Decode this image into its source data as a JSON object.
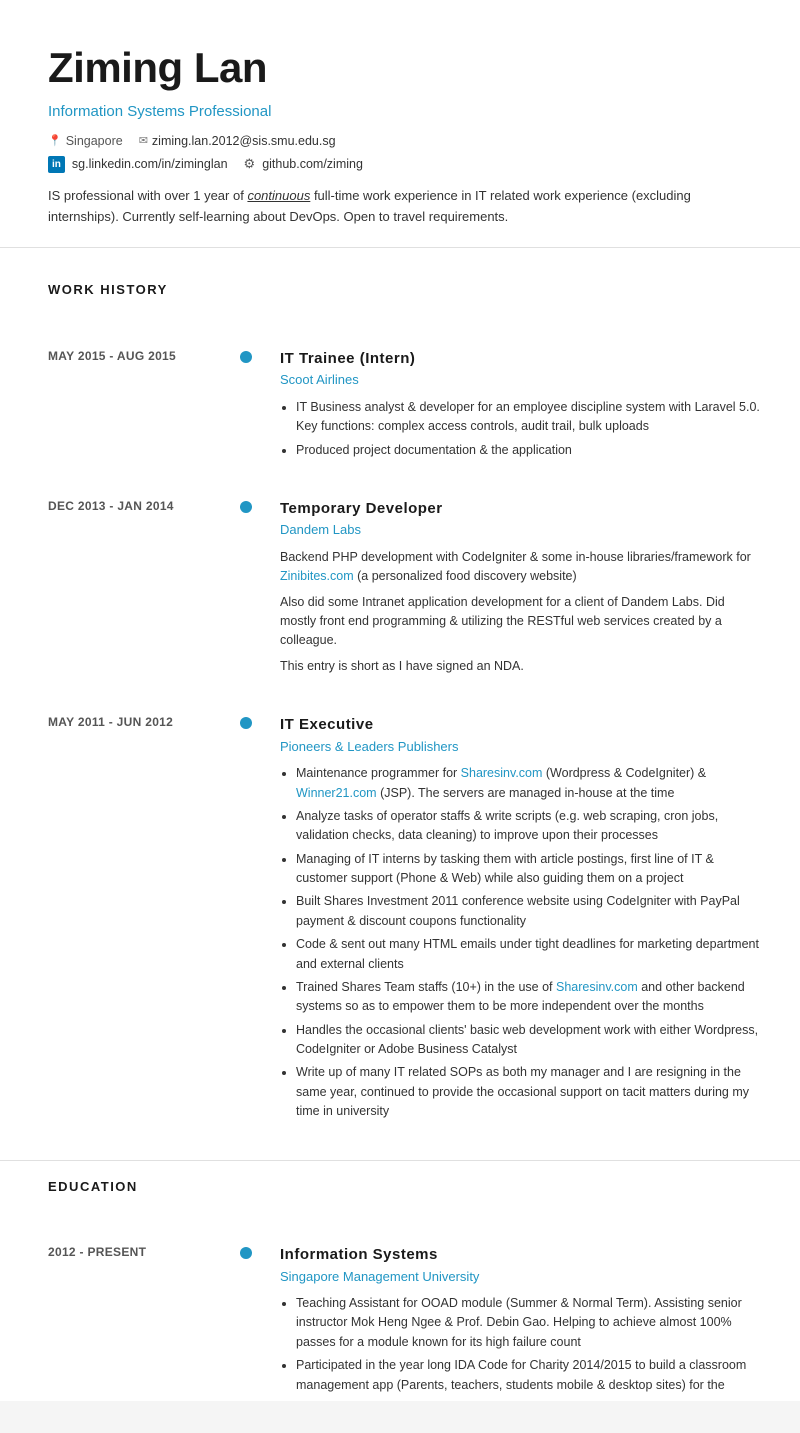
{
  "header": {
    "name": "Ziming Lan",
    "profession": "Information Systems Professional",
    "location": "Singapore",
    "email": "ziming.lan.2012@sis.smu.edu.sg",
    "linkedin_label": "in",
    "linkedin_url": "sg.linkedin.com/in/ziminglan",
    "github_url": "github.com/ziming",
    "summary": "IS professional with over 1 year of continuous full-time work experience in IT related work experience (excluding internships). Currently self-learning about DevOps. Open to travel requirements."
  },
  "sections": {
    "work_history_title": "WORK HISTORY",
    "education_title": "EDUCATION"
  },
  "work_entries": [
    {
      "dates": "MAY 2015 - AUG 2015",
      "title": "IT Trainee (Intern)",
      "company": "Scoot Airlines",
      "bullets": [
        "IT Business analyst & developer for an employee discipline system with Laravel 5.0. Key functions: complex access controls, audit trail, bulk uploads",
        "Produced project documentation & the application"
      ],
      "paragraphs": []
    },
    {
      "dates": "DEC 2013 - JAN 2014",
      "title": "Temporary Developer",
      "company": "Dandem Labs",
      "bullets": [],
      "paragraphs": [
        "Backend PHP development with CodeIgniter & some in-house libraries/framework for Zinibites.com (a personalized food discovery website)",
        "Also did some Intranet application development for a client of Dandem Labs. Did mostly front end programming & utilizing the RESTful web services created by a colleague.",
        "This entry is short as I have signed an NDA."
      ],
      "inline_links": [
        {
          "text": "Zinibites.com",
          "url": "#"
        }
      ]
    },
    {
      "dates": "MAY 2011 - JUN 2012",
      "title": "IT Executive",
      "company": "Pioneers & Leaders Publishers",
      "bullets": [
        "Maintenance programmer for Sharesinv.com (Wordpress & CodeIgniter) & Winner21.com (JSP). The servers are managed in-house at the time",
        "Analyze tasks of operator staffs & write scripts (e.g. web scraping, cron jobs, validation checks, data cleaning) to improve upon their processes",
        "Managing of IT interns by tasking them with article postings, first line of IT & customer support (Phone & Web) while also guiding them on a project",
        "Built Shares Investment 2011 conference website using CodeIgniter with PayPal payment & discount coupons functionality",
        "Code & sent out many HTML emails under tight deadlines for marketing department and external clients",
        "Trained Shares Team staffs (10+) in the use of Sharesinv.com and other backend systems so as to empower them to be more independent over the months",
        "Handles the occasional clients' basic web development work with either Wordpress, CodeIgniter or Adobe Business Catalyst",
        "Write up of many IT related SOPs as both my manager and I are resigning in the same year, continued to provide the occasional support on tacit matters during my time in university"
      ],
      "paragraphs": []
    }
  ],
  "education_entries": [
    {
      "dates": "2012 - PRESENT",
      "title": "Information Systems",
      "company": "Singapore Management University",
      "bullets": [
        "Teaching Assistant for OOAD module (Summer & Normal Term). Assisting senior instructor Mok Heng Ngee & Prof. Debin Gao. Helping to achieve almost 100% passes for a module known for its high failure count",
        "Participated in the year long IDA Code for Charity 2014/2015 to build a classroom management app (Parents, teachers, students mobile & desktop sites) for the"
      ],
      "paragraphs": []
    }
  ],
  "colors": {
    "accent": "#2196c4",
    "text_dark": "#1a1a1a",
    "text_mid": "#555",
    "text_light": "#777",
    "divider": "#e0e0e0",
    "dot": "#2196c4"
  }
}
